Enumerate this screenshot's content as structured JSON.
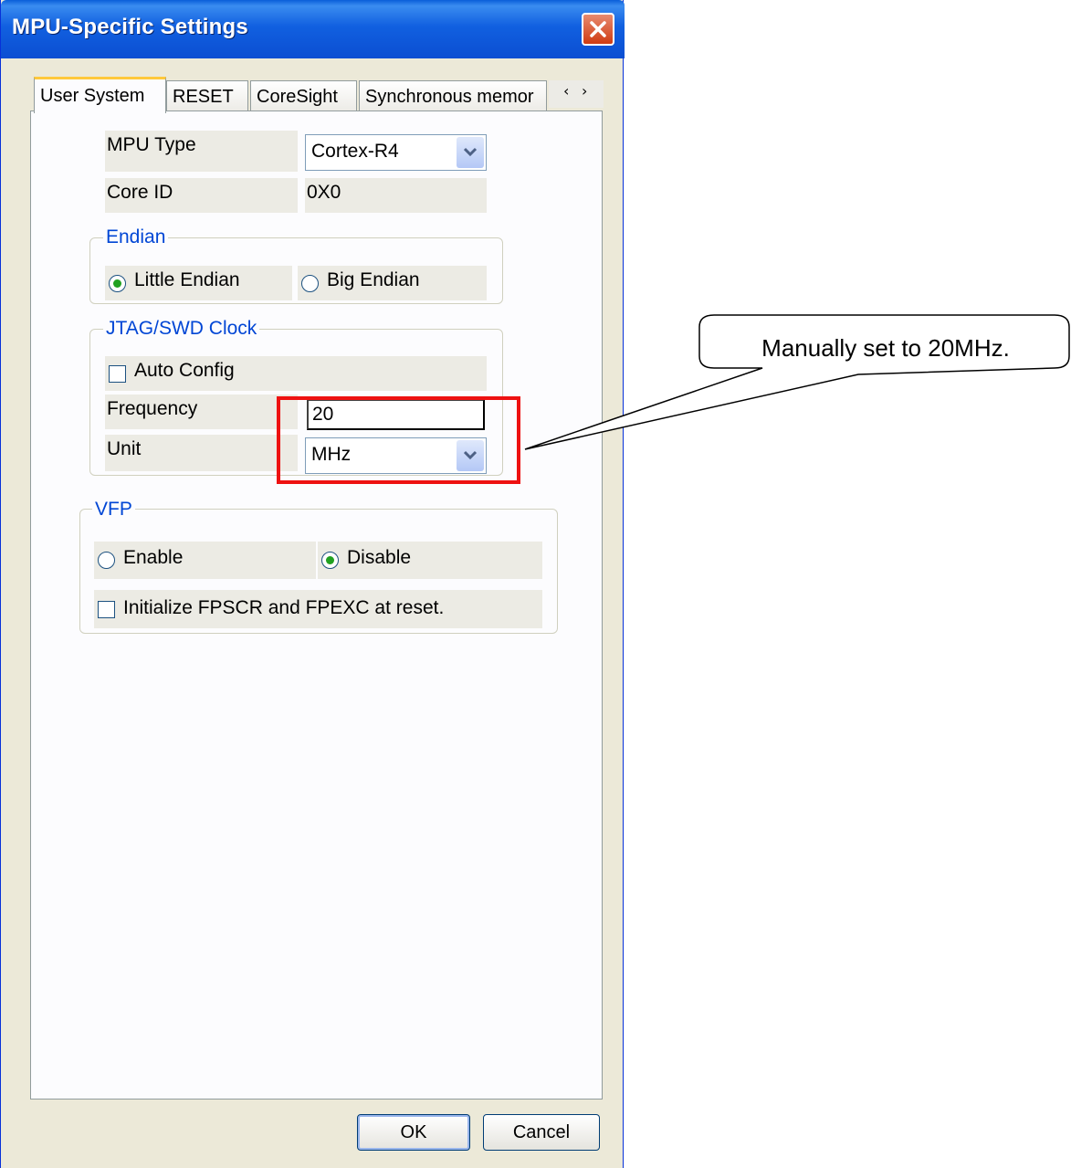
{
  "window": {
    "title": "MPU-Specific Settings"
  },
  "tabs": [
    {
      "label": "User System",
      "active": true
    },
    {
      "label": "RESET"
    },
    {
      "label": "CoreSight"
    },
    {
      "label": "Synchronous memor"
    }
  ],
  "settings": {
    "mpu_type_label": "MPU Type",
    "mpu_type_value": "Cortex-R4",
    "core_id_label": "Core ID",
    "core_id_value": "0X0"
  },
  "endian": {
    "title": "Endian",
    "little": "Little Endian",
    "big": "Big Endian",
    "selected": "Little Endian"
  },
  "jtag": {
    "title": "JTAG/SWD Clock",
    "auto_config": "Auto Config",
    "auto_config_checked": false,
    "frequency_label": "Frequency",
    "frequency_value": "20",
    "unit_label": "Unit",
    "unit_value": "MHz"
  },
  "vfp": {
    "title": "VFP",
    "enable": "Enable",
    "disable": "Disable",
    "selected": "Disable",
    "init_label": "Initialize FPSCR and FPEXC at reset.",
    "init_checked": false
  },
  "buttons": {
    "ok": "OK",
    "cancel": "Cancel"
  },
  "annotation": {
    "callout": "Manually set to 20MHz.",
    "highlight_color": "#ee1111"
  },
  "colors": {
    "title_bar": "#0b4ed2",
    "group_title": "#0046d5",
    "dialog_bg": "#ece9d8"
  }
}
